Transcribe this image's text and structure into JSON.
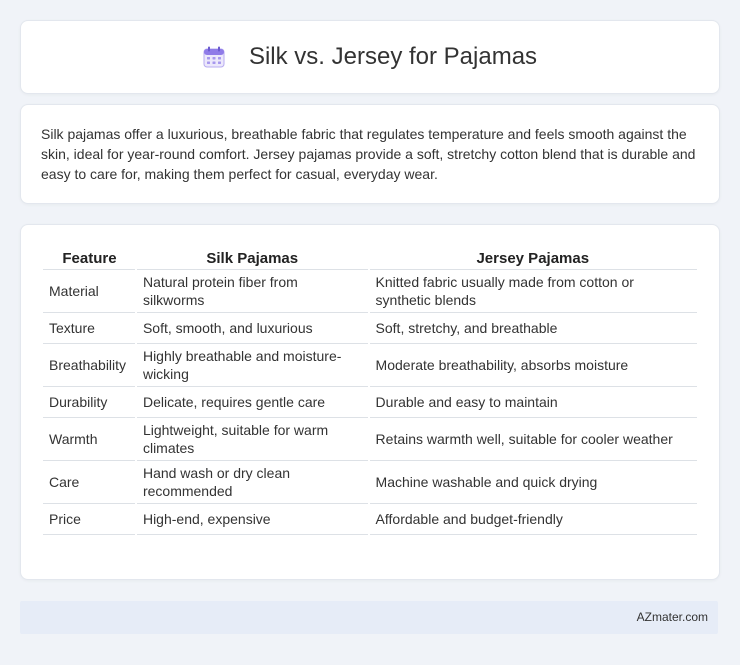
{
  "header": {
    "title": "Silk vs. Jersey for Pajamas"
  },
  "intro": {
    "text": "Silk pajamas offer a luxurious, breathable fabric that regulates temperature and feels smooth against the skin, ideal for year-round comfort. Jersey pajamas provide a soft, stretchy cotton blend that is durable and easy to care for, making them perfect for casual, everyday wear."
  },
  "table": {
    "headers": [
      "Feature",
      "Silk Pajamas",
      "Jersey Pajamas"
    ],
    "rows": [
      [
        "Material",
        "Natural protein fiber from silkworms",
        "Knitted fabric usually made from cotton or synthetic blends"
      ],
      [
        "Texture",
        "Soft, smooth, and luxurious",
        "Soft, stretchy, and breathable"
      ],
      [
        "Breathability",
        "Highly breathable and moisture-wicking",
        "Moderate breathability, absorbs moisture"
      ],
      [
        "Durability",
        "Delicate, requires gentle care",
        "Durable and easy to maintain"
      ],
      [
        "Warmth",
        "Lightweight, suitable for warm climates",
        "Retains warmth well, suitable for cooler weather"
      ],
      [
        "Care",
        "Hand wash or dry clean recommended",
        "Machine washable and quick drying"
      ],
      [
        "Price",
        "High-end, expensive",
        "Affordable and budget-friendly"
      ]
    ]
  },
  "footer": {
    "brand": "AZmater.com"
  },
  "icons": {
    "title_icon": "calendar-icon"
  },
  "colors": {
    "background": "#f0f3f8",
    "footer_bg": "#e6ecf7",
    "icon_accent": "#8f7be8"
  }
}
